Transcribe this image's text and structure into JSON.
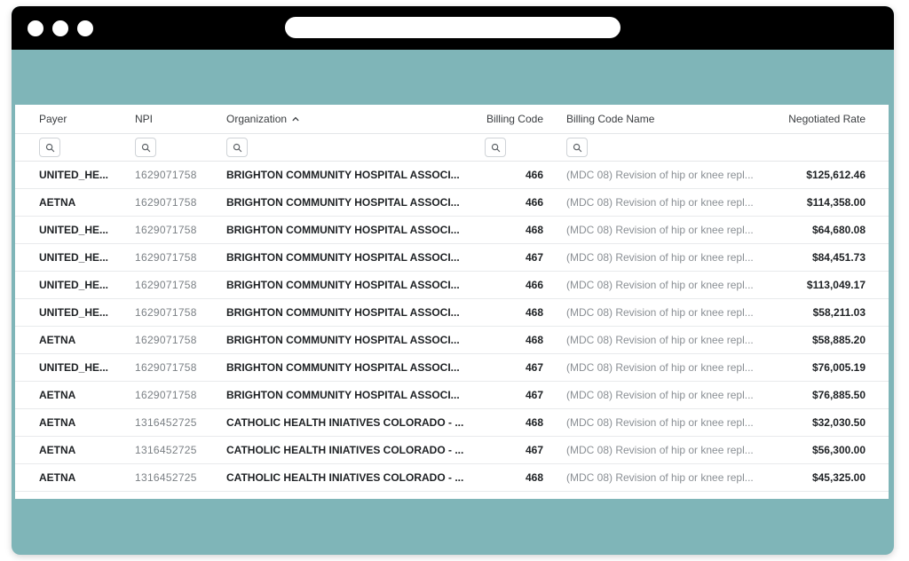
{
  "columns": {
    "payer": "Payer",
    "npi": "NPI",
    "organization": "Organization",
    "billing_code": "Billing Code",
    "billing_code_name": "Billing Code Name",
    "negotiated_rate": "Negotiated Rate"
  },
  "sort": {
    "column": "organization",
    "direction": "ascending",
    "icon": "chevron-up-icon"
  },
  "filter_icons": [
    "search-icon",
    "search-icon",
    "search-icon",
    "search-icon",
    "search-icon"
  ],
  "rows": [
    {
      "payer": "UNITED_HE...",
      "npi": "1629071758",
      "organization": "BRIGHTON COMMUNITY HOSPITAL ASSOCI...",
      "billing_code": "466",
      "billing_code_name": "(MDC 08) Revision of hip or knee repl...",
      "negotiated_rate": "$125,612.46"
    },
    {
      "payer": "AETNA",
      "npi": "1629071758",
      "organization": "BRIGHTON COMMUNITY HOSPITAL ASSOCI...",
      "billing_code": "466",
      "billing_code_name": "(MDC 08) Revision of hip or knee repl...",
      "negotiated_rate": "$114,358.00"
    },
    {
      "payer": "UNITED_HE...",
      "npi": "1629071758",
      "organization": "BRIGHTON COMMUNITY HOSPITAL ASSOCI...",
      "billing_code": "468",
      "billing_code_name": "(MDC 08) Revision of hip or knee repl...",
      "negotiated_rate": "$64,680.08"
    },
    {
      "payer": "UNITED_HE...",
      "npi": "1629071758",
      "organization": "BRIGHTON COMMUNITY HOSPITAL ASSOCI...",
      "billing_code": "467",
      "billing_code_name": "(MDC 08) Revision of hip or knee repl...",
      "negotiated_rate": "$84,451.73"
    },
    {
      "payer": "UNITED_HE...",
      "npi": "1629071758",
      "organization": "BRIGHTON COMMUNITY HOSPITAL ASSOCI...",
      "billing_code": "466",
      "billing_code_name": "(MDC 08) Revision of hip or knee repl...",
      "negotiated_rate": "$113,049.17"
    },
    {
      "payer": "UNITED_HE...",
      "npi": "1629071758",
      "organization": "BRIGHTON COMMUNITY HOSPITAL ASSOCI...",
      "billing_code": "468",
      "billing_code_name": "(MDC 08) Revision of hip or knee repl...",
      "negotiated_rate": "$58,211.03"
    },
    {
      "payer": "AETNA",
      "npi": "1629071758",
      "organization": "BRIGHTON COMMUNITY HOSPITAL ASSOCI...",
      "billing_code": "468",
      "billing_code_name": "(MDC 08) Revision of hip or knee repl...",
      "negotiated_rate": "$58,885.20"
    },
    {
      "payer": "UNITED_HE...",
      "npi": "1629071758",
      "organization": "BRIGHTON COMMUNITY HOSPITAL ASSOCI...",
      "billing_code": "467",
      "billing_code_name": "(MDC 08) Revision of hip or knee repl...",
      "negotiated_rate": "$76,005.19"
    },
    {
      "payer": "AETNA",
      "npi": "1629071758",
      "organization": "BRIGHTON COMMUNITY HOSPITAL ASSOCI...",
      "billing_code": "467",
      "billing_code_name": "(MDC 08) Revision of hip or knee repl...",
      "negotiated_rate": "$76,885.50"
    },
    {
      "payer": "AETNA",
      "npi": "1316452725",
      "organization": "CATHOLIC HEALTH INIATIVES COLORADO - ...",
      "billing_code": "468",
      "billing_code_name": "(MDC 08) Revision of hip or knee repl...",
      "negotiated_rate": "$32,030.50"
    },
    {
      "payer": "AETNA",
      "npi": "1316452725",
      "organization": "CATHOLIC HEALTH INIATIVES COLORADO - ...",
      "billing_code": "467",
      "billing_code_name": "(MDC 08) Revision of hip or knee repl...",
      "negotiated_rate": "$56,300.00"
    },
    {
      "payer": "AETNA",
      "npi": "1316452725",
      "organization": "CATHOLIC HEALTH INIATIVES COLORADO - ...",
      "billing_code": "468",
      "billing_code_name": "(MDC 08) Revision of hip or knee repl...",
      "negotiated_rate": "$45,325.00"
    }
  ],
  "colors": {
    "window_background": "#7fb5b8",
    "titlebar": "#000000",
    "table_background": "#ffffff",
    "text_dark": "#1e2124",
    "text_muted": "#8a8f94"
  }
}
